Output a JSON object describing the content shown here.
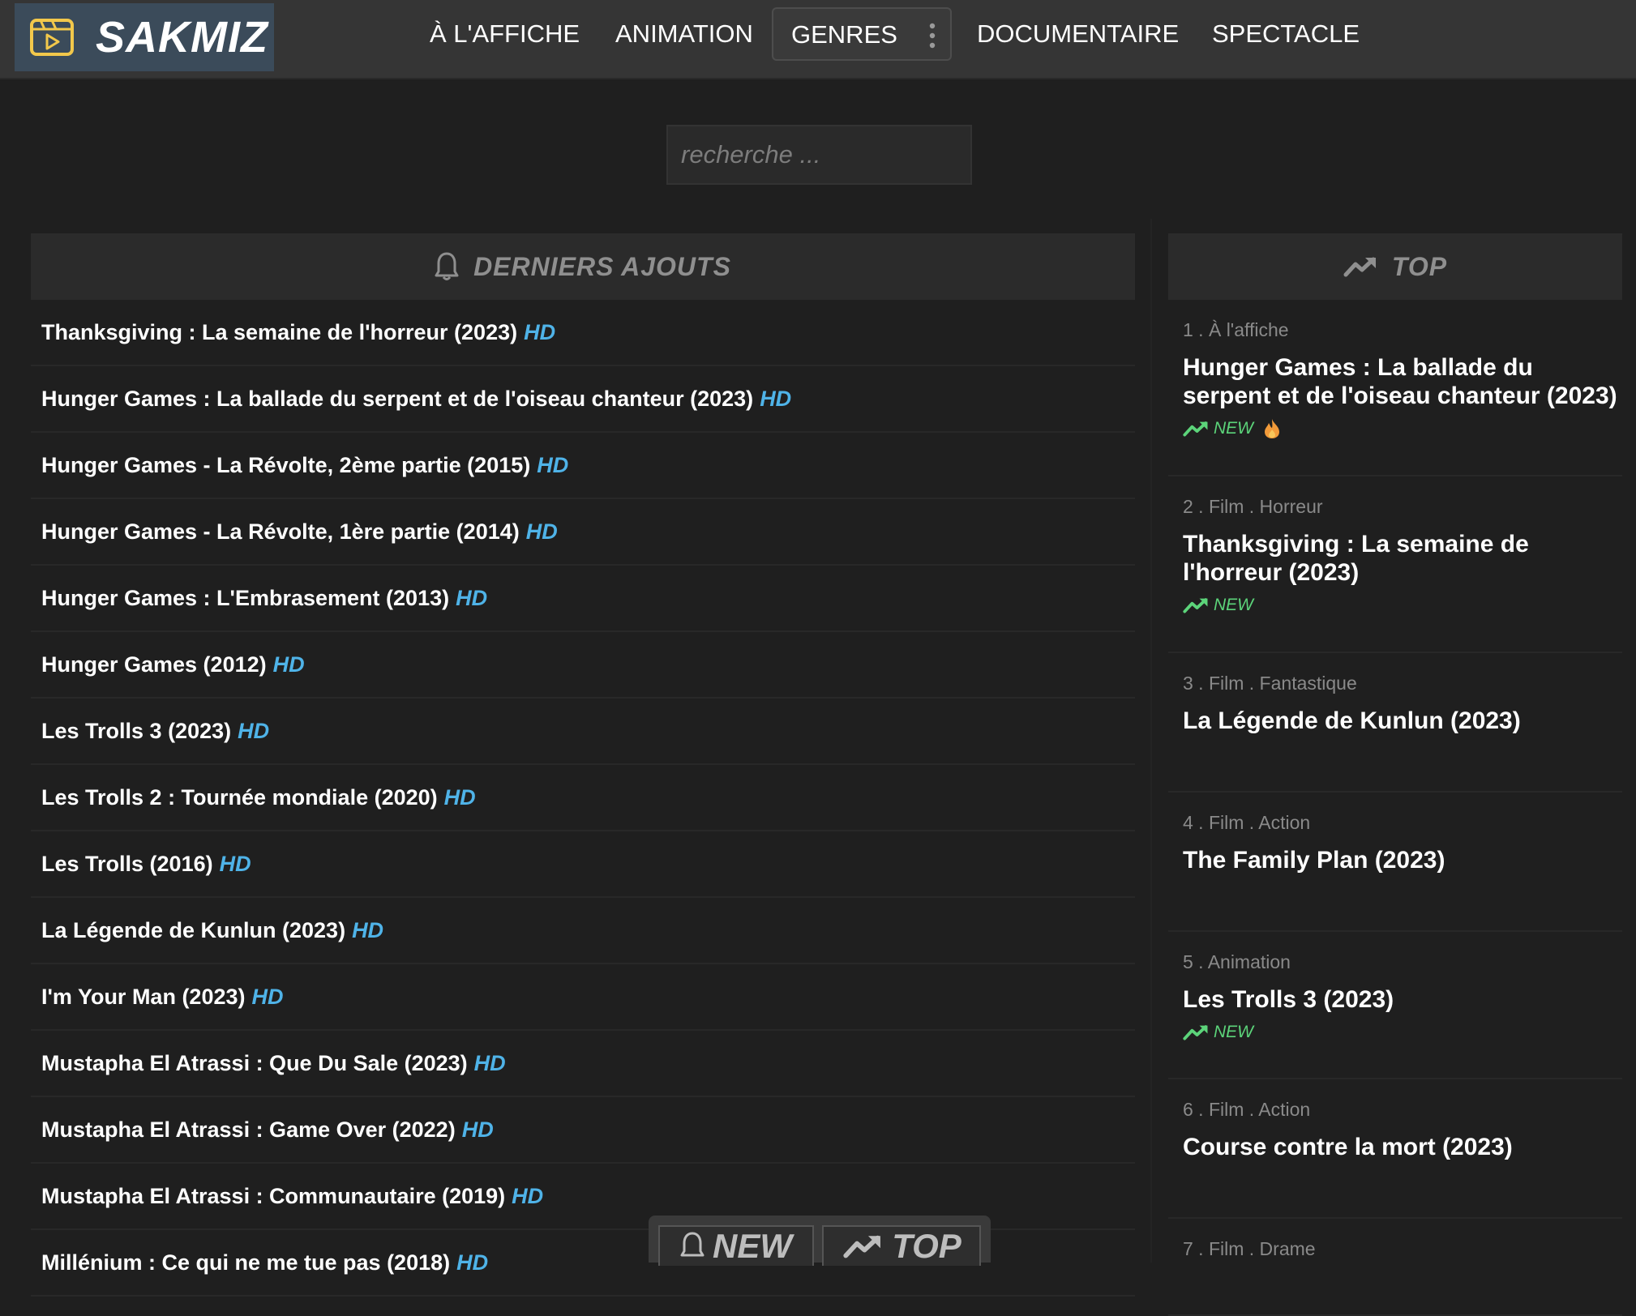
{
  "brand": {
    "name": "SAKMIZ"
  },
  "nav": {
    "items": [
      "À L'AFFICHE",
      "ANIMATION",
      "GENRES",
      "DOCUMENTAIRE",
      "SPECTACLE"
    ]
  },
  "search": {
    "placeholder": "recherche ..."
  },
  "latest": {
    "heading": "DERNIERS AJOUTS",
    "hd_label": "HD",
    "items": [
      "Thanksgiving : La semaine de l'horreur (2023)",
      "Hunger Games : La ballade du serpent et de l'oiseau chanteur (2023)",
      "Hunger Games - La Révolte, 2ème partie (2015)",
      "Hunger Games - La Révolte, 1ère partie (2014)",
      "Hunger Games : L'Embrasement (2013)",
      "Hunger Games (2012)",
      "Les Trolls 3 (2023)",
      "Les Trolls 2 : Tournée mondiale (2020)",
      "Les Trolls (2016)",
      "La Légende de Kunlun (2023)",
      "I'm Your Man (2023)",
      "Mustapha El Atrassi : Que Du Sale (2023)",
      "Mustapha El Atrassi : Game Over (2022)",
      "Mustapha El Atrassi : Communautaire (2019)",
      "Millénium : Ce qui ne me tue pas (2018)"
    ]
  },
  "top": {
    "heading": "TOP",
    "new_label": "NEW",
    "items": [
      {
        "category": "1 . À l'affiche",
        "title": "Hunger Games : La ballade du serpent et de l'oiseau chanteur (2023)",
        "new": true,
        "hot": true
      },
      {
        "category": "2 . Film . Horreur",
        "title": "Thanksgiving : La semaine de l'horreur (2023)",
        "new": true,
        "hot": false
      },
      {
        "category": "3 . Film . Fantastique",
        "title": "La Légende de Kunlun (2023)",
        "new": false,
        "hot": false
      },
      {
        "category": "4 . Film . Action",
        "title": "The Family Plan (2023)",
        "new": false,
        "hot": false
      },
      {
        "category": "5 . Animation",
        "title": "Les Trolls 3 (2023)",
        "new": true,
        "hot": false
      },
      {
        "category": "6 . Film . Action",
        "title": "Course contre la mort (2023)",
        "new": false,
        "hot": false
      },
      {
        "category": "7 . Film . Drame",
        "title": "",
        "new": false,
        "hot": false
      }
    ]
  },
  "float_toggle": {
    "new_label": "NEW",
    "top_label": "TOP"
  },
  "colors": {
    "hd": "#4fb3e8",
    "new": "#5cd47a",
    "header_bg": "#353535",
    "page_bg": "#1f1f1f",
    "logo_bg": "#3b4b5a"
  },
  "icons": [
    "video-play-icon",
    "kebab-menu-icon",
    "bell-icon",
    "trending-up-icon",
    "fire-icon"
  ]
}
